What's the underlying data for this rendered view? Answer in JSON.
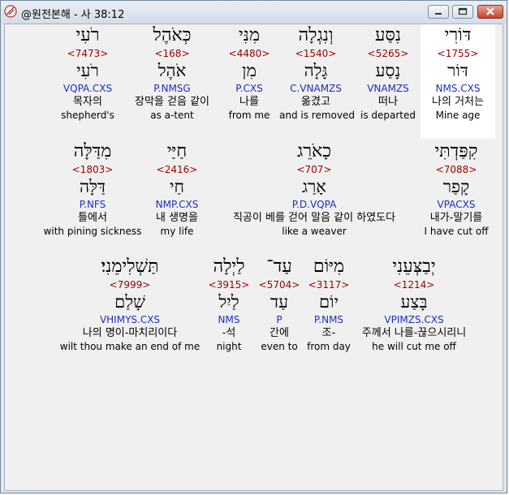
{
  "window": {
    "title": "@원전본해 - 사 38:12",
    "icon": "app-logo-icon",
    "buttons": [
      "minimize-icon",
      "maximize-icon",
      "close-icon"
    ]
  },
  "rows": [
    [
      {
        "heb": "דּוֹרִי",
        "strong": "<1755>",
        "lemma": "דּוֹר",
        "morph": "NMS.CXS",
        "ko": "나의 거처는",
        "en": "Mine age",
        "selected": true
      },
      {
        "heb": "נִסַּע",
        "strong": "<5265>",
        "lemma": "נָסַע",
        "morph": "VNAMZS",
        "ko": "떠나",
        "en": "is departed"
      },
      {
        "heb": "וְנִגְלָה",
        "strong": "<1540>",
        "lemma": "גָּלָה",
        "morph": "C.VNAMZS",
        "ko": "옮겼고",
        "en": "and is removed"
      },
      {
        "heb": "מִנִּי",
        "strong": "<4480>",
        "lemma": "מִן",
        "morph": "P.CXS",
        "ko": "나를",
        "en": "from me"
      },
      {
        "heb": "כְּאֹהֶל",
        "strong": "<168>",
        "lemma": "אֹהֶל",
        "morph": "P.NMSG",
        "ko": "장막을 걷음 같이",
        "en": "as a-tent"
      },
      {
        "heb": "רֹעִי",
        "strong": "<7473>",
        "lemma": "רֹעִי",
        "morph": "VQPA.CXS",
        "ko": "목자의",
        "en": "shepherd's"
      }
    ],
    [
      {
        "heb": "קִפַּדְתִּי",
        "strong": "<7088>",
        "lemma": "קָפַר",
        "morph": "VPACXS",
        "ko": "내가-말기를",
        "en": "I have cut off"
      },
      {
        "heb": "כָאֹרֵג",
        "strong": "<707>",
        "lemma": "אָרַג",
        "morph": "P.D.VQPA",
        "ko": "직공이 베를 걷어 말음 같이 하였도다",
        "en": "like a weaver"
      },
      {
        "heb": "חַיַּי",
        "strong": "<2416>",
        "lemma": "חַי",
        "morph": "NMP.CXS",
        "ko": "내 생명을",
        "en": "my life"
      },
      {
        "heb": "מִדַּלָּה",
        "strong": "<1803>",
        "lemma": "דַּלָּה",
        "morph": "P.NFS",
        "ko": "틀에서",
        "en": "with pining sickness"
      }
    ],
    [
      {
        "heb": "יְבַצְּעֵנִי",
        "strong": "<1214>",
        "lemma": "בָּצַע",
        "morph": "VPIMZS.CXS",
        "ko": "주께서 나를-끊으시리니",
        "en": "he will cut me off"
      },
      {
        "heb": "מִיּוֹם",
        "strong": "<3117>",
        "lemma": "יוֹם",
        "morph": "P.NMS",
        "ko": "조-",
        "en": "from day"
      },
      {
        "heb": "עַד־",
        "strong": "<5704>",
        "lemma": "עַד",
        "morph": "P",
        "ko": "간에",
        "en": "even to"
      },
      {
        "heb": "לַיְלָה",
        "strong": "<3915>",
        "lemma": "לַיִל",
        "morph": "NMS",
        "ko": "-석",
        "en": "night"
      },
      {
        "heb": "תַּשְׁלִימֵנִי׃",
        "strong": "<7999>",
        "lemma": "שָׁלַם",
        "morph": "VHIMYS.CXS",
        "ko": "나의 명이-마치리이다",
        "en": "wilt thou make an end of me"
      }
    ]
  ]
}
